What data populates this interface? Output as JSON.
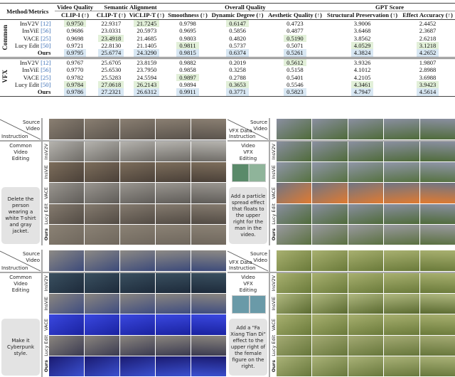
{
  "table": {
    "method_header": "Method/Metrics",
    "groups": [
      "Video Quality",
      "Semantic Alignment",
      "Overall Quality",
      "GPT Score"
    ],
    "metrics": [
      "CLIP-I (↑)",
      "CLIP-T (↑)",
      "ViCLIP-T (↑)",
      "Smoothness (↑)",
      "Dynamic Degree (↑)",
      "Aesthetic Quality (↑)",
      "Structural Preservation (↑)",
      "Effect Accuracy (↑)"
    ],
    "highlight_colors": {
      "g": "#e2f0d9",
      "b": "#d8e7f3"
    },
    "sections": [
      {
        "label": "Common",
        "rows": [
          {
            "method": "InsV2V",
            "cite": "[12]",
            "values": [
              "0.9750",
              "22.9317",
              "21.7245",
              "0.9798",
              "0.6147",
              "0.4723",
              "3.9006",
              "2.4452"
            ],
            "hl": [
              "g",
              "",
              "g",
              "",
              "g",
              "",
              "",
              ""
            ]
          },
          {
            "method": "InsViE",
            "cite": "[56]",
            "values": [
              "0.9686",
              "23.0331",
              "20.5973",
              "0.9695",
              "0.5856",
              "0.4877",
              "3.6468",
              "2.3687"
            ],
            "hl": [
              "",
              "",
              "",
              "",
              "",
              "",
              "",
              ""
            ]
          },
          {
            "method": "VACE",
            "cite": "[25]",
            "values": [
              "0.9698",
              "23.4918",
              "21.4685",
              "0.9803",
              "0.4820",
              "0.5190",
              "3.8562",
              "2.6218"
            ],
            "hl": [
              "",
              "g",
              "",
              "",
              "",
              "g",
              "",
              ""
            ]
          },
          {
            "method": "Lucy Edit",
            "cite": "[50]",
            "values": [
              "0.9721",
              "22.8130",
              "21.1405",
              "0.9811",
              "0.5737",
              "0.5071",
              "4.0529",
              "3.1218"
            ],
            "hl": [
              "",
              "",
              "",
              "g",
              "",
              "",
              "g",
              "g"
            ]
          },
          {
            "method": "Ours",
            "cite": "",
            "values": [
              "0.9795",
              "25.6774",
              "24.3290",
              "0.9815",
              "0.6374",
              "0.5261",
              "4.3824",
              "4.2652"
            ],
            "hl": [
              "b",
              "b",
              "b",
              "b",
              "b",
              "b",
              "b",
              "b"
            ]
          }
        ]
      },
      {
        "label": "VFX",
        "rows": [
          {
            "method": "InsV2V",
            "cite": "[12]",
            "values": [
              "0.9767",
              "25.6705",
              "23.8159",
              "0.9882",
              "0.2019",
              "0.5612",
              "3.9326",
              "1.9807"
            ],
            "hl": [
              "",
              "",
              "",
              "",
              "",
              "g",
              "",
              ""
            ]
          },
          {
            "method": "InsViE",
            "cite": "[56]",
            "values": [
              "0.9770",
              "25.6530",
              "23.7950",
              "0.9858",
              "0.3258",
              "0.5158",
              "4.1012",
              "2.8988"
            ],
            "hl": [
              "",
              "",
              "",
              "",
              "",
              "",
              "",
              ""
            ]
          },
          {
            "method": "VACE",
            "cite": "[25]",
            "values": [
              "0.9782",
              "25.5283",
              "24.5594",
              "0.9897",
              "0.2788",
              "0.5401",
              "4.2105",
              "3.6988"
            ],
            "hl": [
              "",
              "",
              "",
              "g",
              "",
              "",
              "",
              ""
            ]
          },
          {
            "method": "Lucy Edit",
            "cite": "[50]",
            "values": [
              "0.9784",
              "27.0618",
              "26.2143",
              "0.9894",
              "0.3653",
              "0.5546",
              "4.3461",
              "3.9423"
            ],
            "hl": [
              "g",
              "g",
              "g",
              "",
              "g",
              "",
              "g",
              "g"
            ]
          },
          {
            "method": "Ours",
            "cite": "",
            "values": [
              "0.9786",
              "27.2321",
              "26.6312",
              "0.9911",
              "0.3771",
              "0.5823",
              "4.7947",
              "4.5614"
            ],
            "hl": [
              "b",
              "b",
              "b",
              "b",
              "b",
              "b",
              "b",
              "b"
            ]
          }
        ]
      }
    ]
  },
  "figure": {
    "row_labels": [
      "InsV2V",
      "InsViE",
      "VACE",
      "Lucy Edit",
      "Ours"
    ],
    "panels": [
      {
        "source_label": "Source Video",
        "corner_label": "Instruction",
        "category": "Common Video Editing",
        "instruction": "Delete the person wearing a white T-shirt and gray jacket.",
        "thumb": false,
        "palette": {
          "src": [
            "#8a7f72",
            "#5a534c"
          ],
          "rows": [
            [
              "#b5b3ae",
              "#6e6b66"
            ],
            [
              "#7d6e5c",
              "#4a4038"
            ],
            [
              "#9a9690",
              "#5f5c58"
            ],
            [
              "#857b6f",
              "#524b44"
            ],
            [
              "#8b8275",
              "#6f675d"
            ]
          ]
        }
      },
      {
        "source_label": "Source Video",
        "corner_label": "VFX Data Instruction",
        "category": "Video VFX Editing",
        "instruction": "Add a particle spread effect that floats to the upper right for the man in the video.",
        "thumb": true,
        "palette": {
          "src": [
            "#8a8fa0",
            "#4f6b3a"
          ],
          "rows": [
            [
              "#8a8fa0",
              "#4f6b3a"
            ],
            [
              "#9096a8",
              "#557140"
            ],
            [
              "#707584",
              "#e07a30"
            ],
            [
              "#8a8fa0",
              "#4f6b3a"
            ],
            [
              "#9a9aa0",
              "#5a7040"
            ]
          ]
        }
      },
      {
        "source_label": "Source Video",
        "corner_label": "Instruction",
        "category": "Common Video Editing",
        "instruction": "Make it Cyberpunk style.",
        "thumb": false,
        "palette": {
          "src": [
            "#8d8a85",
            "#3c4a7a"
          ],
          "rows": [
            [
              "#3a5060",
              "#1d2a3a"
            ],
            [
              "#8a8680",
              "#3e4c80"
            ],
            [
              "#3a48e0",
              "#1a22a0"
            ],
            [
              "#8a857e",
              "#3a3a50"
            ],
            [
              "#1a1a70",
              "#3a50d0"
            ]
          ]
        }
      },
      {
        "source_label": "Source Video",
        "corner_label": "VFX Data Instruction",
        "category": "Video VFX Editing",
        "instruction": "Add a \"Fa Xiang Tian Di\" effect to the upper right of the female figure on the right.",
        "thumb": true,
        "palette": {
          "src": [
            "#a8b070",
            "#6a7a3a"
          ],
          "rows": [
            [
              "#a8b070",
              "#6a7a3a"
            ],
            [
              "#b0b880",
              "#5a6a30"
            ],
            [
              "#a8b070",
              "#6a7a3a"
            ],
            [
              "#a4aa74",
              "#66763a"
            ],
            [
              "#aab278",
              "#68783c"
            ]
          ]
        }
      }
    ]
  }
}
